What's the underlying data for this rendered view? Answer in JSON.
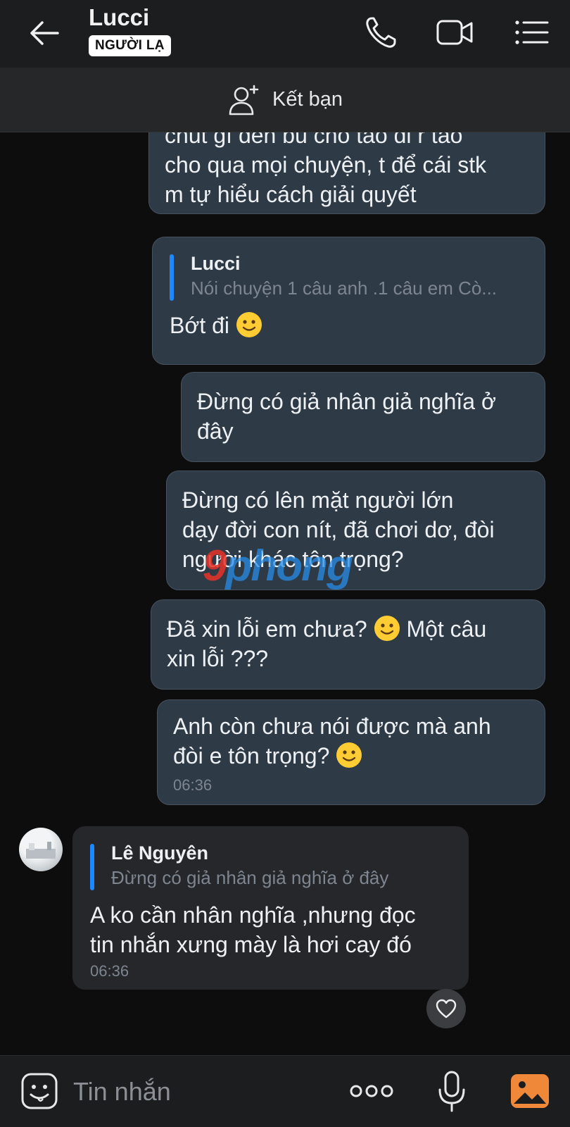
{
  "header": {
    "name": "Lucci",
    "badge": "NGƯỜI LẠ"
  },
  "friend_bar": {
    "label": "Kết bạn"
  },
  "messages": [
    {
      "side": "out",
      "text": "chút gì đến bù cho tao đi r tao\ncho qua mọi chuyện, t để cái stk\nm tự hiểu cách giải quyết"
    },
    {
      "side": "out",
      "quote_name": "Lucci",
      "quote_text": "Nói chuyện 1 câu anh .1 câu em  Cò...",
      "text": "Bớt đi",
      "emoji": "smile"
    },
    {
      "side": "out",
      "text": "Đừng có giả nhân giả nghĩa ở\nđây"
    },
    {
      "side": "out",
      "text": "Đừng có lên mặt người lớn\ndạy đời con nít, đã chơi dơ, đòi\nngười khác tôn trọng?"
    },
    {
      "side": "out",
      "text_a": "Đã xin lỗi em chưa?",
      "text_b": "Một câu\nxin lỗi ???",
      "emoji": "smile"
    },
    {
      "side": "out",
      "text": "Anh còn chưa nói được mà anh\nđòi e tôn trọng?",
      "emoji": "smile",
      "time": "06:36"
    },
    {
      "side": "in",
      "quote_name": "Lê Nguyên",
      "quote_text": "Đừng có giả nhân giả nghĩa ở đây",
      "text": "A ko cần nhân nghĩa ,nhưng đọc\ntin nhắn xưng mày là hơi cay đó",
      "time": "06:36"
    }
  ],
  "watermark": {
    "part1": "9",
    "part2": "phong"
  },
  "composer": {
    "placeholder": "Tin nhắn"
  },
  "colors": {
    "background": "#0d0d0e",
    "bubble_out": "#2f3a47",
    "bubble_in": "#26272a",
    "quote_bar": "#1e88ff",
    "gallery_accent": "#f0883a"
  }
}
